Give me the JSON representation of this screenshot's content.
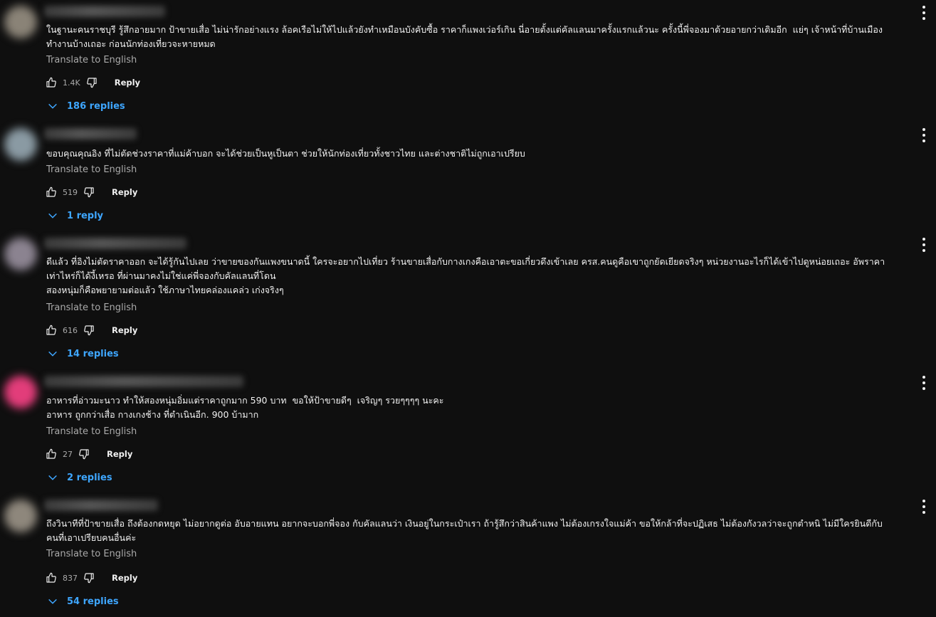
{
  "labels": {
    "translate": "Translate to English",
    "reply": "Reply"
  },
  "colors": {
    "background": "#0f0f0f",
    "text": "#f1f1f1",
    "muted": "#aaaaaa",
    "link": "#3ea6ff"
  },
  "comments": [
    {
      "text": "ในฐานะคนราชบุรี รู้สึกอายมาก ป้าขายเสื่อ ไม่น่ารักอย่างแรง ล้อคเรือไม่ให้ไปแล้วยังทำเหมือนบังคับซื้อ ราคาก็แพงเว่อร์เกิน นี่อายตั้งแต่คัลแลนมาครั้งแรกแล้วนะ ครั้งนี้พี่จองมาด้วยอายกว่าเดิมอีก  แย่ๆ เจ้าหน้าที่บ้านเมือง\nทำงานบ้างเถอะ ก่อนนักท่องเที่ยวจะหายหมด",
      "likes": "1.4K",
      "replies": "186 replies",
      "avatar_color": "#8a8377"
    },
    {
      "text": "ขอบคุณคุณอิง ที่ไม่ตัดช่วงราคาที่แม่ค้าบอก จะได้ช่วยเป็นหูเป็นตา ช่วยให้นักท่องเที่ยวทั้งชาวไทย และต่างชาติไม่ถูกเอาเปรียบ",
      "likes": "519",
      "replies": "1 reply",
      "avatar_color": "#8a9aa3"
    },
    {
      "text": "ดีแล้ว ที่อิงไม่ตัดราคาออก จะได้รู้กันไปเลย ว่าขายของกันแพงขนาดนี้ ใครจะอยากไปเที่ยว ร้านขายเสื่อกับกางเกงคือเอาตะขอเกี่ยวดึงเข้าเลย ครส.คนดูคือเขาถูกยัดเยียดจริงๆ หน่วยงานอะไรก็ได้เข้าไปดูหน่อยเถอะ อัพราคา\nเท่าไหร่ก็ได้งี้เหรอ ที่ผ่านมาคงไม่ใช่แค่พี่จองกับคัลแลนที่โดน\nสองหนุ่มก็คือพยายามต่อแล้ว ใช้ภาษาไทยคล่องแคล่ว เก่งจริงๆ",
      "likes": "616",
      "replies": "14 replies",
      "avatar_color": "#8b8390"
    },
    {
      "text": "อาหารที่อ่าวมะนาว ทำให้สองหนุ่มอิ่มแต่ราคาถูกมาก 590 บาท  ขอให้ป้าขายดีๆ  เจริญๆ รวยๆๆๆๆ นะคะ\nอาหาร ถูกกว่าเสื่อ กางเกงช้าง ที่ตำเนินอีก. 900 บ้ามาก",
      "likes": "27",
      "replies": "2 replies",
      "avatar_color": "#e23d7a"
    },
    {
      "text": "ถึงวินาทีที่ป้าขายเสื่อ ถึงต้องกดหยุด ไม่อยากดูต่อ อับอายแทน อยากจะบอกพี่จอง กับคัลแลนว่า เงินอยู่ในกระเป๋าเรา ถ้ารู้สึกว่าสินค้าแพง ไม่ต้องเกรงใจแม่ค้า ขอให้กล้าที่จะปฏิเสธ ไม่ต้องกังวลว่าจะถูกตำหนิ ไม่มีใครยินดีกับ\nคนที่เอาเปรียบคนอื่นค่ะ",
      "likes": "837",
      "replies": "54 replies",
      "avatar_color": "#8e877c"
    }
  ]
}
